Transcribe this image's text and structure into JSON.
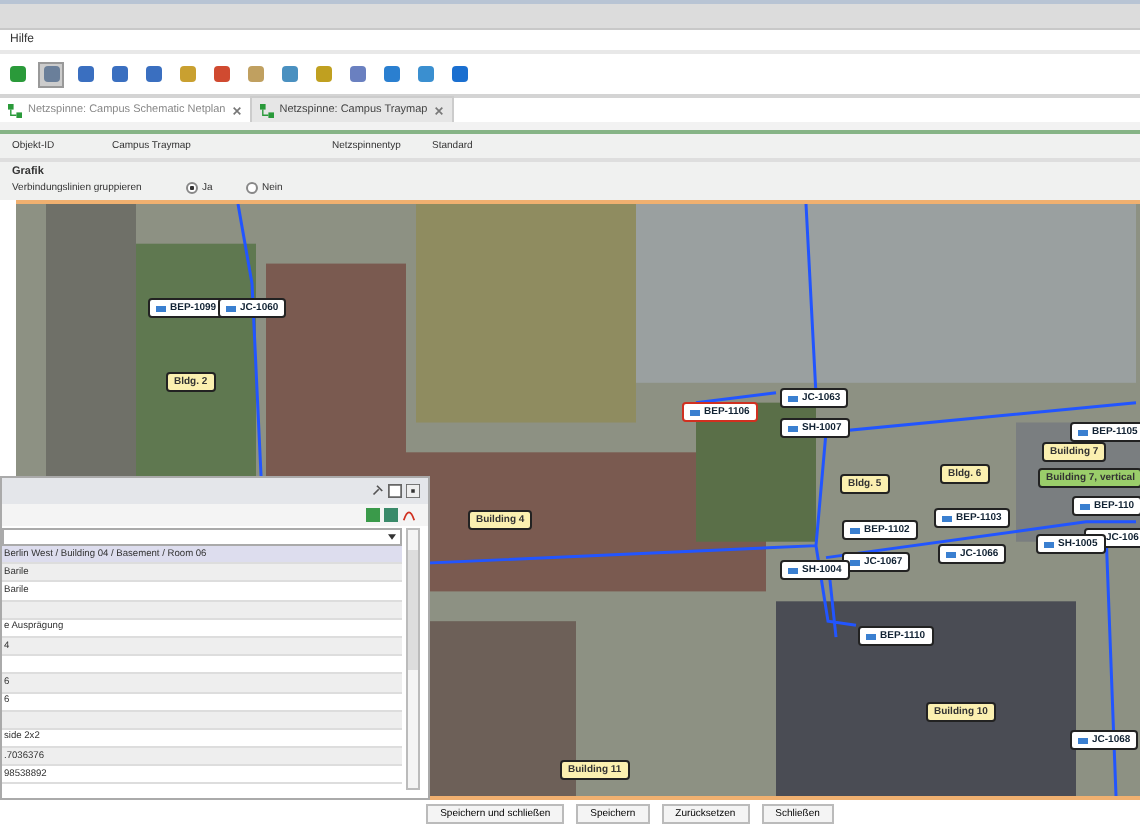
{
  "menu": [
    "Hilfe"
  ],
  "tabs": [
    {
      "label": "Netzspinne: Campus Schematic Netplan",
      "selected": false
    },
    {
      "label": "Netzspinne: Campus Traymap",
      "selected": true
    }
  ],
  "form": {
    "fields": [
      {
        "label": "Objekt-ID",
        "value": "Campus Traymap"
      },
      {
        "label": "Netzspinnentyp",
        "value": "Standard"
      }
    ],
    "section": "Grafik",
    "radio_label": "Verbindungslinien gruppieren",
    "options": [
      {
        "label": "Ja",
        "selected": true
      },
      {
        "label": "Nein",
        "selected": false
      }
    ]
  },
  "map": {
    "nodes": [
      {
        "kind": "device",
        "label": "BEP-1099",
        "selected": false
      },
      {
        "kind": "device",
        "label": "JC-1060",
        "selected": false
      },
      {
        "kind": "building",
        "label": "Bldg. 2"
      },
      {
        "kind": "building",
        "label": "Building 4"
      },
      {
        "kind": "device",
        "label": "BEP-1106",
        "selected": true
      },
      {
        "kind": "device",
        "label": "JC-1063",
        "selected": false
      },
      {
        "kind": "device",
        "label": "SH-1007",
        "selected": false
      },
      {
        "kind": "building",
        "label": "Bldg. 5"
      },
      {
        "kind": "building",
        "label": "Bldg. 6"
      },
      {
        "kind": "device",
        "label": "BEP-1105",
        "selected": false
      },
      {
        "kind": "building",
        "label": "Building 7"
      },
      {
        "kind": "building_alt",
        "label": "Building 7, vertical"
      },
      {
        "kind": "device",
        "label": "BEP-110",
        "selected": false
      },
      {
        "kind": "device",
        "label": "JC-106",
        "selected": false
      },
      {
        "kind": "device",
        "label": "BEP-1102",
        "selected": false
      },
      {
        "kind": "device",
        "label": "BEP-1103",
        "selected": false
      },
      {
        "kind": "device",
        "label": "JC-1067",
        "selected": false
      },
      {
        "kind": "device",
        "label": "JC-1066",
        "selected": false
      },
      {
        "kind": "device",
        "label": "SH-1005",
        "selected": false
      },
      {
        "kind": "device",
        "label": "SH-1004",
        "selected": false
      },
      {
        "kind": "device",
        "label": "BEP-1110",
        "selected": false
      },
      {
        "kind": "building",
        "label": "Building 10"
      },
      {
        "kind": "device",
        "label": "JC-1068",
        "selected": false
      },
      {
        "kind": "building",
        "label": "Building 11"
      }
    ]
  },
  "panel": {
    "rows": [
      {
        "text": "Berlin West / Building 04 / Basement / Room 06",
        "selected": true
      },
      {
        "text": "Barile",
        "selected": false
      },
      {
        "text": "Barile",
        "selected": false
      },
      {
        "selected": false
      },
      {
        "text": "e Ausprägung",
        "selected": false
      },
      {
        "text": "4",
        "selected": false
      },
      {
        "selected": false
      },
      {
        "text": "6",
        "selected": false
      },
      {
        "text": "6",
        "selected": false
      },
      {
        "selected": false
      },
      {
        "text": "side 2x2",
        "selected": false
      },
      {
        "text": ".7036376",
        "selected": false
      },
      {
        "text": "98538892",
        "selected": false
      }
    ]
  },
  "buttons": [
    "Speichern und schließen",
    "Speichern",
    "Zurücksetzen",
    "Schließen"
  ]
}
